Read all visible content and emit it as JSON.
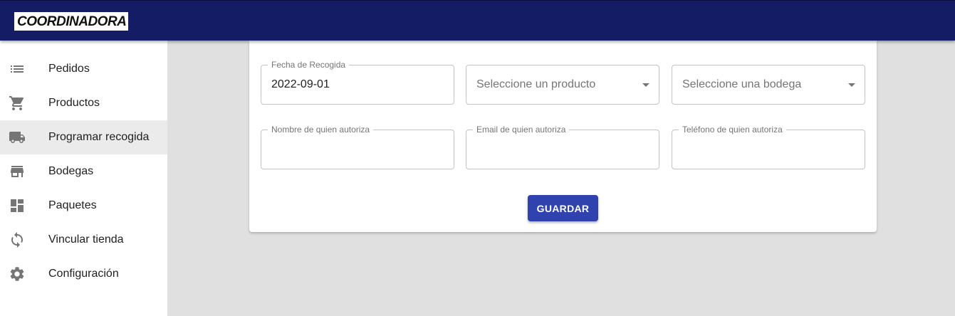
{
  "header": {
    "logo_text": "COORDINADORA",
    "logo_prefix": "C",
    "logo_oo": "OO",
    "logo_suffix": "RDINADORA",
    "colors": {
      "appbar": "#131c64",
      "logo_accent": "#1f4fd1"
    }
  },
  "sidebar": {
    "items": [
      {
        "label": "Pedidos",
        "icon": "list-icon"
      },
      {
        "label": "Productos",
        "icon": "shopping-cart-icon"
      },
      {
        "label": "Programar recogida",
        "icon": "truck-icon",
        "active": true
      },
      {
        "label": "Bodegas",
        "icon": "store-icon"
      },
      {
        "label": "Paquetes",
        "icon": "dashboard-icon"
      },
      {
        "label": "Vincular tienda",
        "icon": "sync-icon"
      },
      {
        "label": "Configuración",
        "icon": "gear-icon"
      }
    ]
  },
  "form": {
    "fecha": {
      "label": "Fecha de Recogida",
      "value": "2022-09-01"
    },
    "producto": {
      "placeholder": "Seleccione un producto"
    },
    "bodega": {
      "placeholder": "Seleccione una bodega"
    },
    "nombre": {
      "label": "Nombre de quien autoriza",
      "value": ""
    },
    "email": {
      "label": "Email de quien autoriza",
      "value": ""
    },
    "telefono": {
      "label": "Teléfono de quien autoriza",
      "value": ""
    },
    "submit_label": "GUARDAR",
    "colors": {
      "button": "#3042ae"
    }
  }
}
